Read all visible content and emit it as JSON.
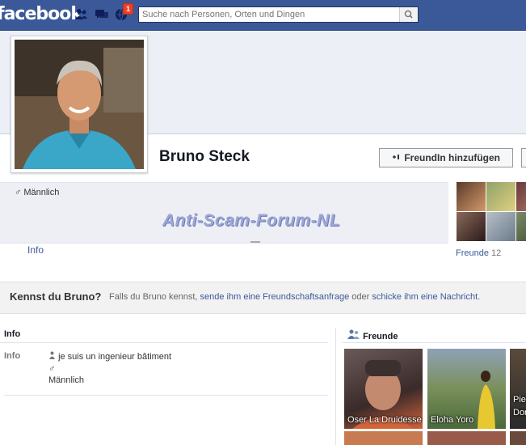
{
  "header": {
    "logo": "facebook",
    "notification_count": "1",
    "search_placeholder": "Suche nach Personen, Orten und Dingen"
  },
  "profile": {
    "name": "Bruno Steck",
    "add_friend_label": "FreundIn hinzufügen",
    "gender": "Männlich",
    "watermark": "Anti-Scam-Forum-NL",
    "tab_info": "Info",
    "tab_friends": "Freunde",
    "friends_count": "12"
  },
  "know_box": {
    "title": "Kennst du Bruno?",
    "text_1": "Falls du Bruno kennst,",
    "link_1": "sende ihm eine Freundschaftsanfrage",
    "text_2": "oder",
    "link_2": "schicke ihm eine Nachricht",
    "text_3": "."
  },
  "info_section": {
    "heading": "Info",
    "label": "Info",
    "work": "je suis un ingenieur bâtiment",
    "gender": "Männlich"
  },
  "friends_section": {
    "heading": "Freunde",
    "friends": [
      {
        "name": "Oser La Druidesse"
      },
      {
        "name": "Eloha Yoro"
      },
      {
        "name": "Pier"
      },
      {
        "name": "Dor"
      }
    ]
  },
  "colors": {
    "brand": "#3b5998",
    "badge": "#f03d25"
  },
  "icons": [
    "friend-requests-icon",
    "messages-icon",
    "notifications-icon",
    "search-icon",
    "add-friend-icon",
    "male-icon",
    "person-icon",
    "friends-icon"
  ]
}
